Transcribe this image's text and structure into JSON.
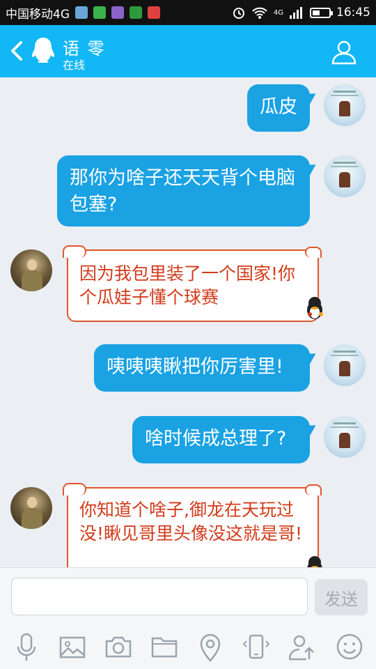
{
  "status_bar": {
    "carrier": "中国移动4G",
    "network": "4G",
    "time": "16:45",
    "battery_level": 0.45
  },
  "header": {
    "contact_name": "语 零",
    "contact_status": "在线",
    "back_icon": "chevron-left-icon",
    "profile_icon": "person-icon"
  },
  "messages": [
    {
      "from": "me",
      "text": "瓜皮"
    },
    {
      "from": "me",
      "text": "那你为啥子还天天背个电脑包塞?"
    },
    {
      "from": "other",
      "text": "因为我包里装了一个国家!你个瓜娃子懂个球赛"
    },
    {
      "from": "me",
      "text": "咦咦咦瞅把你厉害里!"
    },
    {
      "from": "me",
      "text": "啥时候成总理了?"
    },
    {
      "from": "other",
      "text": "你知道个啥子,御龙在天玩过没!瞅见哥里头像没这就是哥!"
    }
  ],
  "composer": {
    "input_value": "",
    "send_label": "发送"
  },
  "toolbar": [
    {
      "icon": "microphone-icon"
    },
    {
      "icon": "image-icon"
    },
    {
      "icon": "camera-icon"
    },
    {
      "icon": "folder-icon"
    },
    {
      "icon": "location-pin-icon"
    },
    {
      "icon": "shake-phone-icon"
    },
    {
      "icon": "share-contact-icon"
    },
    {
      "icon": "emoji-icon"
    }
  ],
  "colors": {
    "header": "#12b7f5",
    "outgoing_bubble": "#1aa2e3",
    "incoming_text": "#d23a1a",
    "incoming_border": "#e0562b",
    "background": "#ebeef2"
  }
}
